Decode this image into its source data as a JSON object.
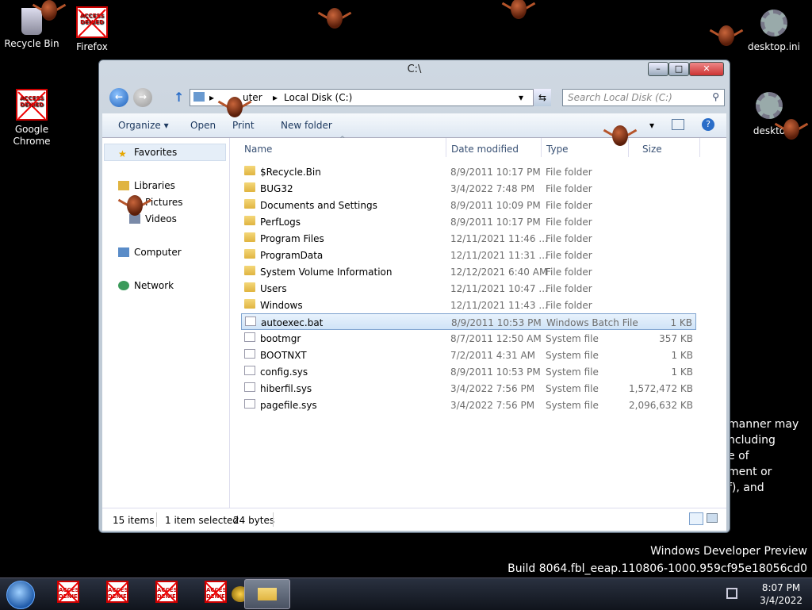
{
  "desktop": {
    "icons": [
      {
        "label": "Recycle Bin"
      },
      {
        "label": "Firefox"
      },
      {
        "label": "desktop.ini"
      },
      {
        "label": "Google\nChrome"
      },
      {
        "label": "deskto"
      }
    ],
    "denied_label": "ACCESS DENIED",
    "background_text": [
      "manner may",
      "ncluding",
      "e of",
      "ment or",
      "f), and"
    ],
    "build": [
      "Windows Developer Preview",
      "Build 8064.fbl_eeap.110806-1000.959cf95e18056cd0"
    ]
  },
  "window": {
    "title": "C:\\",
    "controls": {
      "minimize": "–",
      "maximize": "□",
      "close": "✕"
    },
    "address": {
      "crumbs": "▸ Computer ▸ Local Disk (C:)",
      "partial_visible": "uter",
      "drive": "Local Disk (C:)"
    },
    "search_placeholder": "Search Local Disk (C:)",
    "toolbar": {
      "organize": "Organize ▾",
      "open": "Open",
      "print": "Print",
      "new_folder": "New folder"
    },
    "nav": {
      "favorites": "Favorites",
      "libraries": "Libraries",
      "pictures": "Pictures",
      "videos": "Videos",
      "computer": "Computer",
      "network": "Network"
    },
    "columns": {
      "name": "Name",
      "date": "Date modified",
      "type": "Type",
      "size": "Size"
    },
    "files": [
      {
        "name": "$Recycle.Bin",
        "date": "8/9/2011 10:17 PM",
        "type": "File folder",
        "size": "",
        "kind": "folder"
      },
      {
        "name": "BUG32",
        "date": "3/4/2022 7:48 PM",
        "type": "File folder",
        "size": "",
        "kind": "folder"
      },
      {
        "name": "Documents and Settings",
        "date": "8/9/2011 10:09 PM",
        "type": "File folder",
        "size": "",
        "kind": "link"
      },
      {
        "name": "PerfLogs",
        "date": "8/9/2011 10:17 PM",
        "type": "File folder",
        "size": "",
        "kind": "folder"
      },
      {
        "name": "Program Files",
        "date": "12/11/2021 11:46 ...",
        "type": "File folder",
        "size": "",
        "kind": "folder"
      },
      {
        "name": "ProgramData",
        "date": "12/11/2021 11:31 ...",
        "type": "File folder",
        "size": "",
        "kind": "folder"
      },
      {
        "name": "System Volume Information",
        "date": "12/12/2021 6:40 AM",
        "type": "File folder",
        "size": "",
        "kind": "folder"
      },
      {
        "name": "Users",
        "date": "12/11/2021 10:47 ...",
        "type": "File folder",
        "size": "",
        "kind": "folder"
      },
      {
        "name": "Windows",
        "date": "12/11/2021 11:43 ...",
        "type": "File folder",
        "size": "",
        "kind": "folder"
      },
      {
        "name": "autoexec.bat",
        "date": "8/9/2011 10:53 PM",
        "type": "Windows Batch File",
        "size": "1 KB",
        "kind": "file",
        "selected": true
      },
      {
        "name": "bootmgr",
        "date": "8/7/2011 12:50 AM",
        "type": "System file",
        "size": "357 KB",
        "kind": "file"
      },
      {
        "name": "BOOTNXT",
        "date": "7/2/2011 4:31 AM",
        "type": "System file",
        "size": "1 KB",
        "kind": "file"
      },
      {
        "name": "config.sys",
        "date": "8/9/2011 10:53 PM",
        "type": "System file",
        "size": "1 KB",
        "kind": "file"
      },
      {
        "name": "hiberfil.sys",
        "date": "3/4/2022 7:56 PM",
        "type": "System file",
        "size": "1,572,472 KB",
        "kind": "file"
      },
      {
        "name": "pagefile.sys",
        "date": "3/4/2022 7:56 PM",
        "type": "System file",
        "size": "2,096,632 KB",
        "kind": "file"
      }
    ],
    "status": {
      "items": "15 items",
      "selected": "1 item selected",
      "bytes": "24 bytes"
    }
  },
  "taskbar": {
    "time": "8:07 PM",
    "date": "3/4/2022"
  }
}
